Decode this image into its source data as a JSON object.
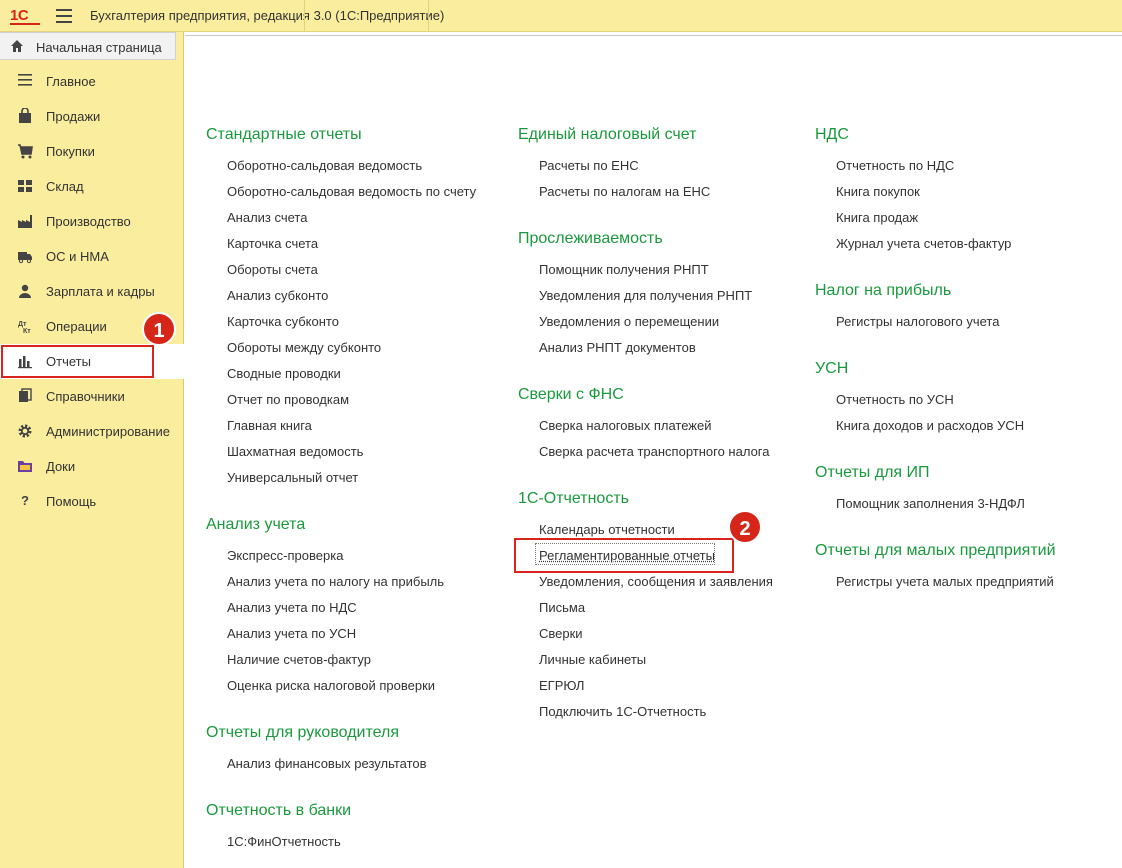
{
  "titlebar": {
    "logo": "1С",
    "title": "Бухгалтерия предприятия, редакция 3.0  (1С:Предприятие)"
  },
  "sidebar": {
    "home": "Начальная страница",
    "items": [
      {
        "label": "Главное",
        "icon": "menu-lines-icon"
      },
      {
        "label": "Продажи",
        "icon": "bag-icon"
      },
      {
        "label": "Покупки",
        "icon": "cart-icon"
      },
      {
        "label": "Склад",
        "icon": "grid-icon"
      },
      {
        "label": "Производство",
        "icon": "factory-icon"
      },
      {
        "label": "ОС и НМА",
        "icon": "truck-icon"
      },
      {
        "label": "Зарплата и кадры",
        "icon": "person-icon"
      },
      {
        "label": "Операции",
        "icon": "dt-kt-icon"
      },
      {
        "label": "Отчеты",
        "icon": "bar-chart-icon"
      },
      {
        "label": "Справочники",
        "icon": "books-icon"
      },
      {
        "label": "Администрирование",
        "icon": "gear-icon"
      },
      {
        "label": "Доки",
        "icon": "folder-icon"
      },
      {
        "label": "Помощь",
        "icon": "question-icon"
      }
    ]
  },
  "badges": {
    "one": "1",
    "two": "2"
  },
  "columns": {
    "c1": {
      "s1": {
        "title": "Стандартные отчеты",
        "links": [
          "Оборотно-сальдовая ведомость",
          "Оборотно-сальдовая ведомость по счету",
          "Анализ счета",
          "Карточка счета",
          "Обороты счета",
          "Анализ субконто",
          "Карточка субконто",
          "Обороты между субконто",
          "Сводные проводки",
          "Отчет по проводкам",
          "Главная книга",
          "Шахматная ведомость",
          "Универсальный отчет"
        ]
      },
      "s2": {
        "title": "Анализ учета",
        "links": [
          "Экспресс-проверка",
          "Анализ учета по налогу на прибыль",
          "Анализ учета по НДС",
          "Анализ учета по УСН",
          "Наличие счетов-фактур",
          "Оценка риска налоговой проверки"
        ]
      },
      "s3": {
        "title": "Отчеты для руководителя",
        "links": [
          "Анализ финансовых результатов"
        ]
      },
      "s4": {
        "title": "Отчетность в банки",
        "links": [
          "1С:ФинОтчетность"
        ]
      }
    },
    "c2": {
      "s1": {
        "title": "Единый налоговый счет",
        "links": [
          "Расчеты по ЕНС",
          "Расчеты по налогам на ЕНС"
        ]
      },
      "s2": {
        "title": "Прослеживаемость",
        "links": [
          "Помощник получения РНПТ",
          "Уведомления для получения РНПТ",
          "Уведомления о перемещении",
          "Анализ РНПТ документов"
        ]
      },
      "s3": {
        "title": "Сверки с ФНС",
        "links": [
          "Сверка налоговых платежей",
          "Сверка расчета транспортного налога"
        ]
      },
      "s4": {
        "title": "1С-Отчетность",
        "links": [
          "Календарь отчетности",
          "Регламентированные отчеты",
          "Уведомления, сообщения и заявления",
          "Письма",
          "Сверки",
          "Личные кабинеты",
          "ЕГРЮЛ",
          "Подключить 1С-Отчетность"
        ]
      }
    },
    "c3": {
      "s1": {
        "title": "НДС",
        "links": [
          "Отчетность по НДС",
          "Книга покупок",
          "Книга продаж",
          "Журнал учета счетов-фактур"
        ]
      },
      "s2": {
        "title": "Налог на прибыль",
        "links": [
          "Регистры налогового учета"
        ]
      },
      "s3": {
        "title": "УСН",
        "links": [
          "Отчетность по УСН",
          "Книга доходов и расходов УСН"
        ]
      },
      "s4": {
        "title": "Отчеты для ИП",
        "links": [
          "Помощник заполнения 3-НДФЛ"
        ]
      },
      "s5": {
        "title": "Отчеты для малых предприятий",
        "links": [
          "Регистры учета малых предприятий"
        ]
      }
    }
  },
  "colors": {
    "accent_green": "#1a9a3c",
    "panel_yellow": "#fbed9e",
    "highlight_red": "#d9231d"
  }
}
